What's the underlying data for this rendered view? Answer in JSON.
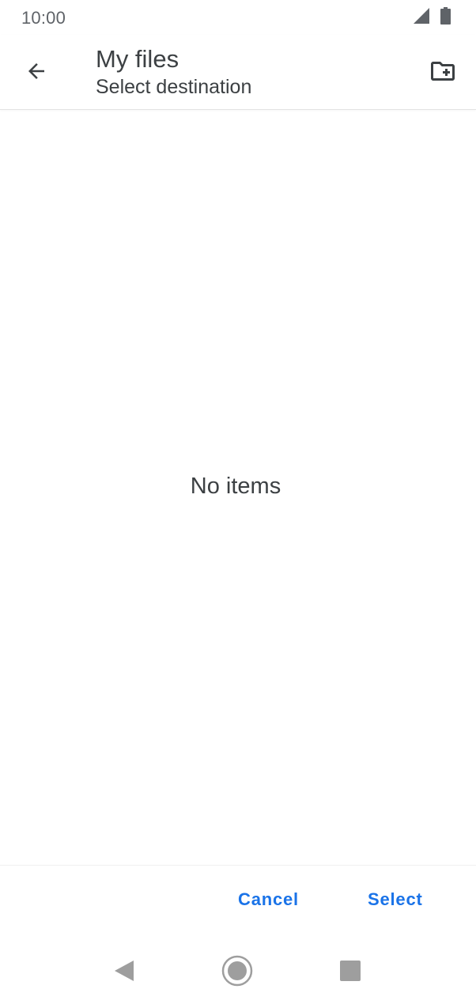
{
  "status_bar": {
    "time": "10:00",
    "icons": [
      "signal-icon",
      "battery-icon"
    ]
  },
  "app_bar": {
    "title": "My files",
    "subtitle": "Select destination",
    "back_icon": "arrow-back-icon",
    "new_folder_icon": "create-new-folder-icon"
  },
  "content": {
    "empty_message": "No items"
  },
  "actions": {
    "cancel_label": "Cancel",
    "select_label": "Select"
  },
  "nav_bar": {
    "icons": [
      "nav-back-icon",
      "nav-home-icon",
      "nav-recents-icon"
    ]
  },
  "colors": {
    "accent": "#1a73e8",
    "text_primary": "#3c4043",
    "text_secondary": "#5f6368",
    "nav_icon": "#9e9e9e"
  }
}
